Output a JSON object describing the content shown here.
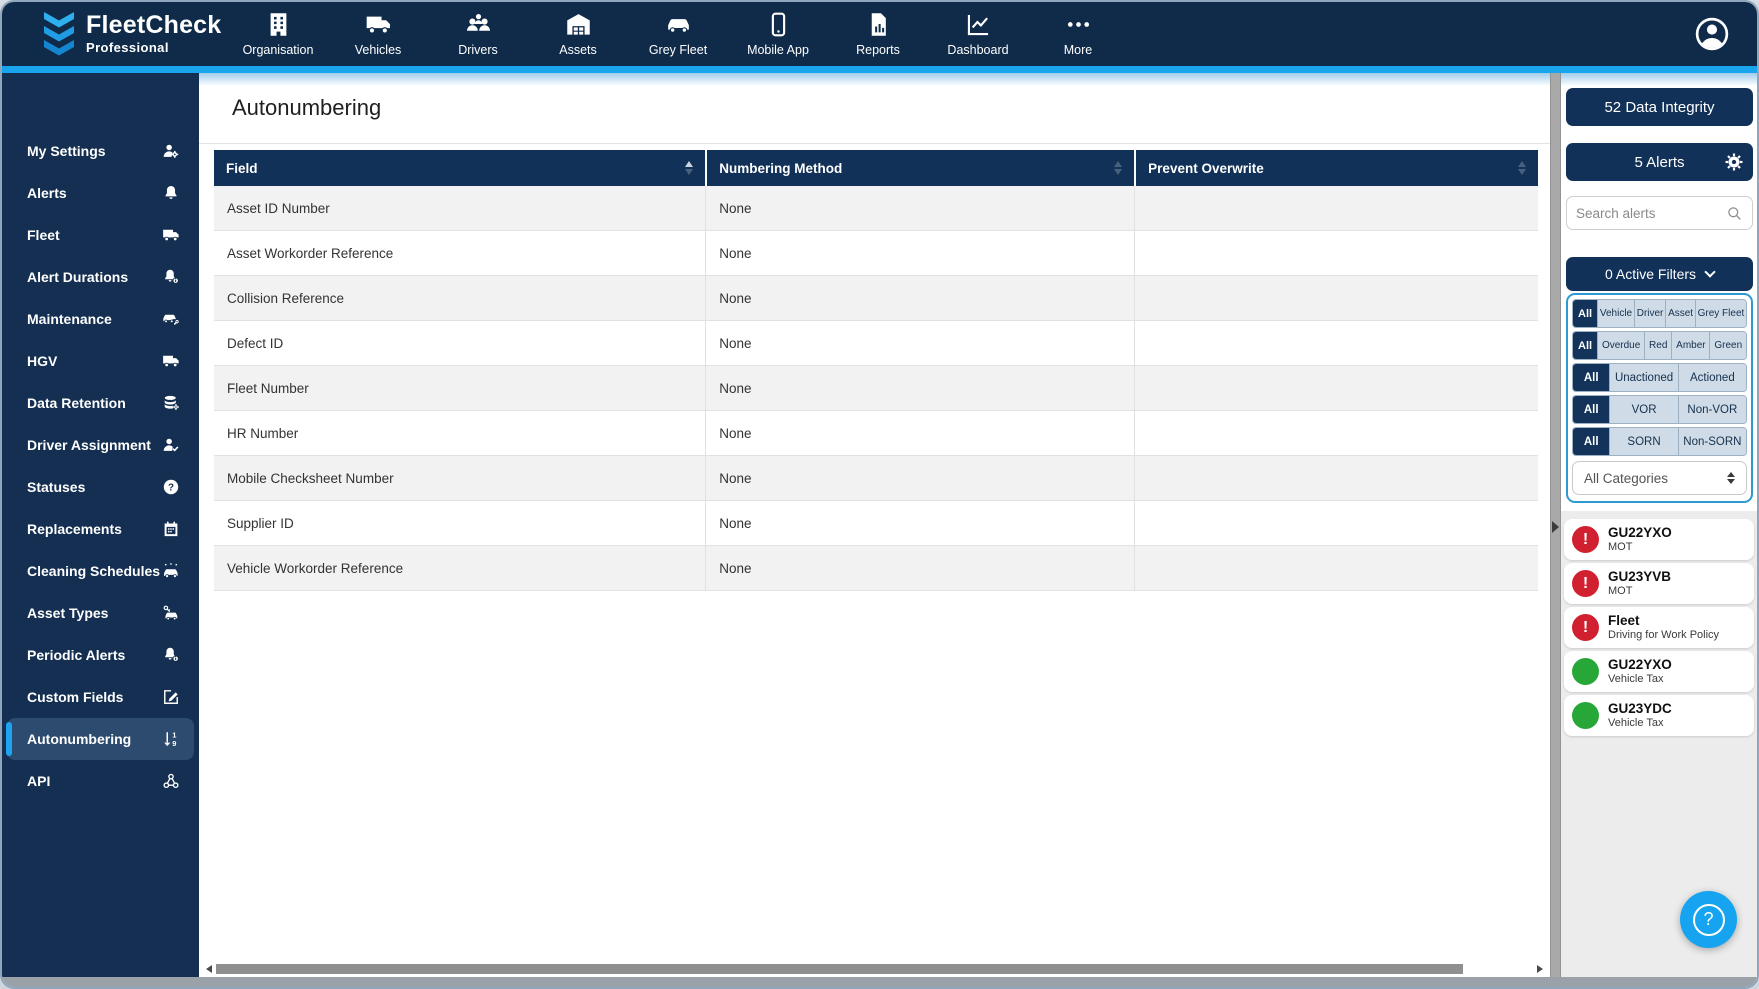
{
  "topbar": {
    "logo": {
      "brand": "FleetCheck",
      "sub": "Professional"
    },
    "items": [
      {
        "label": "Organisation",
        "icon": "building"
      },
      {
        "label": "Vehicles",
        "icon": "truck"
      },
      {
        "label": "Drivers",
        "icon": "users"
      },
      {
        "label": "Assets",
        "icon": "warehouse"
      },
      {
        "label": "Grey Fleet",
        "icon": "car"
      },
      {
        "label": "Mobile App",
        "icon": "phone"
      },
      {
        "label": "Reports",
        "icon": "report"
      },
      {
        "label": "Dashboard",
        "icon": "chart"
      },
      {
        "label": "More",
        "icon": "ellipsis"
      }
    ],
    "avatar_icon": "user-circle"
  },
  "sidebar": {
    "items": [
      {
        "label": "My Settings",
        "icon": "user-gear",
        "selected": false
      },
      {
        "label": "Alerts",
        "icon": "bell",
        "selected": false
      },
      {
        "label": "Fleet",
        "icon": "truck",
        "selected": false
      },
      {
        "label": "Alert Durations",
        "icon": "bell-badge",
        "selected": false
      },
      {
        "label": "Maintenance",
        "icon": "car-wrench",
        "selected": false
      },
      {
        "label": "HGV",
        "icon": "truck",
        "selected": false
      },
      {
        "label": "Data Retention",
        "icon": "database",
        "selected": false
      },
      {
        "label": "Driver Assignment",
        "icon": "user-check",
        "selected": false
      },
      {
        "label": "Statuses",
        "icon": "question",
        "selected": false
      },
      {
        "label": "Replacements",
        "icon": "calendar",
        "selected": false
      },
      {
        "label": "Cleaning Schedules",
        "icon": "car-sparkle",
        "selected": false
      },
      {
        "label": "Asset Types",
        "icon": "cars",
        "selected": false
      },
      {
        "label": "Periodic Alerts",
        "icon": "bell-badge",
        "selected": false
      },
      {
        "label": "Custom Fields",
        "icon": "pen-square",
        "selected": false
      },
      {
        "label": "Autonumbering",
        "icon": "sort-numeric",
        "selected": true
      },
      {
        "label": "API",
        "icon": "webhook",
        "selected": false
      }
    ]
  },
  "main": {
    "title": "Autonumbering",
    "table": {
      "columns": [
        {
          "label": "Field",
          "sort": "asc"
        },
        {
          "label": "Numbering Method",
          "sort": "none"
        },
        {
          "label": "Prevent Overwrite",
          "sort": "none"
        }
      ],
      "rows": [
        {
          "field": "Asset ID Number",
          "numbering_method": "None",
          "prevent_overwrite": ""
        },
        {
          "field": "Asset Workorder Reference",
          "numbering_method": "None",
          "prevent_overwrite": ""
        },
        {
          "field": "Collision Reference",
          "numbering_method": "None",
          "prevent_overwrite": ""
        },
        {
          "field": "Defect ID",
          "numbering_method": "None",
          "prevent_overwrite": ""
        },
        {
          "field": "Fleet Number",
          "numbering_method": "None",
          "prevent_overwrite": ""
        },
        {
          "field": "HR Number",
          "numbering_method": "None",
          "prevent_overwrite": ""
        },
        {
          "field": "Mobile Checksheet Number",
          "numbering_method": "None",
          "prevent_overwrite": ""
        },
        {
          "field": "Supplier ID",
          "numbering_method": "None",
          "prevent_overwrite": ""
        },
        {
          "field": "Vehicle Workorder Reference",
          "numbering_method": "None",
          "prevent_overwrite": ""
        }
      ]
    }
  },
  "right_panel": {
    "data_integrity_label": "52 Data Integrity",
    "alerts_label": "5 Alerts",
    "search_placeholder": "Search alerts",
    "active_filters_label": "0 Active Filters",
    "filter_rows": [
      [
        "All",
        "Vehicle",
        "Driver",
        "Asset",
        "Grey Fleet"
      ],
      [
        "All",
        "Overdue",
        "Red",
        "Amber",
        "Green"
      ],
      [
        "All",
        "Unactioned",
        "Actioned"
      ],
      [
        "All",
        "VOR",
        "Non-VOR"
      ],
      [
        "All",
        "SORN",
        "Non-SORN"
      ]
    ],
    "categories_select": "All Categories",
    "alert_icon_glyph": "!",
    "alerts": [
      {
        "title": "GU22YXO",
        "subtitle": "MOT",
        "status": "red"
      },
      {
        "title": "GU23YVB",
        "subtitle": "MOT",
        "status": "red"
      },
      {
        "title": "Fleet",
        "subtitle": "Driving for Work Policy",
        "status": "red"
      },
      {
        "title": "GU22YXO",
        "subtitle": "Vehicle Tax",
        "status": "green"
      },
      {
        "title": "GU23YDC",
        "subtitle": "Vehicle Tax",
        "status": "green"
      }
    ],
    "help_label": "?"
  },
  "colors": {
    "navy": "#14304f",
    "navy_deep": "#0f2b49",
    "table_header_navy": "#113158",
    "accent_cyan": "#18a5ee",
    "sidebar_selected": "#2c4b6e",
    "chip_bg": "#cfdbe6",
    "filter_border_blue": "#2d9ad2",
    "alert_red": "#d1202f",
    "alert_green": "#27a737",
    "help_blue": "#16a3f0"
  }
}
